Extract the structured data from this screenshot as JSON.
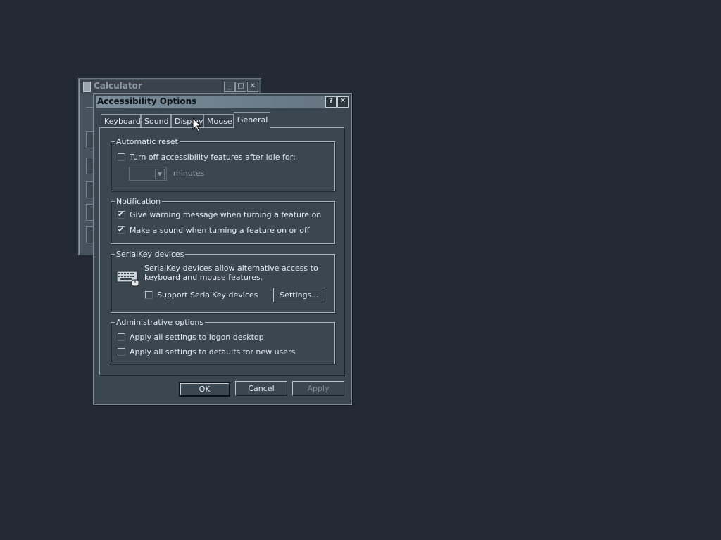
{
  "calculator": {
    "title": "Calculator",
    "title_buttons": [
      "_",
      "□",
      "✕"
    ]
  },
  "dialog": {
    "title": "Accessibility Options",
    "help_button": "?",
    "close_button": "✕",
    "tabs": [
      {
        "label": "Keyboard"
      },
      {
        "label": "Sound"
      },
      {
        "label": "Display"
      },
      {
        "label": "Mouse"
      },
      {
        "label": "General",
        "active": true
      }
    ],
    "automatic_reset": {
      "group_label": "Automatic reset",
      "turn_off_label": "Turn off accessibility features after idle for:",
      "turn_off_checked": false,
      "minutes_value": "",
      "minutes_label": "minutes"
    },
    "notification": {
      "group_label": "Notification",
      "warning_label": "Give warning message when turning a feature on",
      "warning_checked": true,
      "sound_label": "Make a sound when turning a feature on or off",
      "sound_checked": true
    },
    "serialkey": {
      "group_label": "SerialKey devices",
      "description_line1": "SerialKey devices allow alternative access to",
      "description_line2": "keyboard and mouse features.",
      "support_label": "Support SerialKey devices",
      "support_checked": false,
      "settings_button": "Settings..."
    },
    "administrative": {
      "group_label": "Administrative options",
      "logon_label": "Apply all settings to logon desktop",
      "logon_checked": false,
      "defaults_label": "Apply all settings to defaults for new users",
      "defaults_checked": false
    },
    "buttons": {
      "ok": "OK",
      "cancel": "Cancel",
      "apply": "Apply"
    }
  },
  "colors": {
    "desktop": "#242a33",
    "dialog_face": "#3a4650",
    "title_active": "#7d8e9c",
    "text": "#e6ebf0"
  },
  "icons": {
    "keyboard": "keyboard-icon",
    "cursor": "mouse-pointer-icon",
    "calculator": "calculator-icon"
  }
}
